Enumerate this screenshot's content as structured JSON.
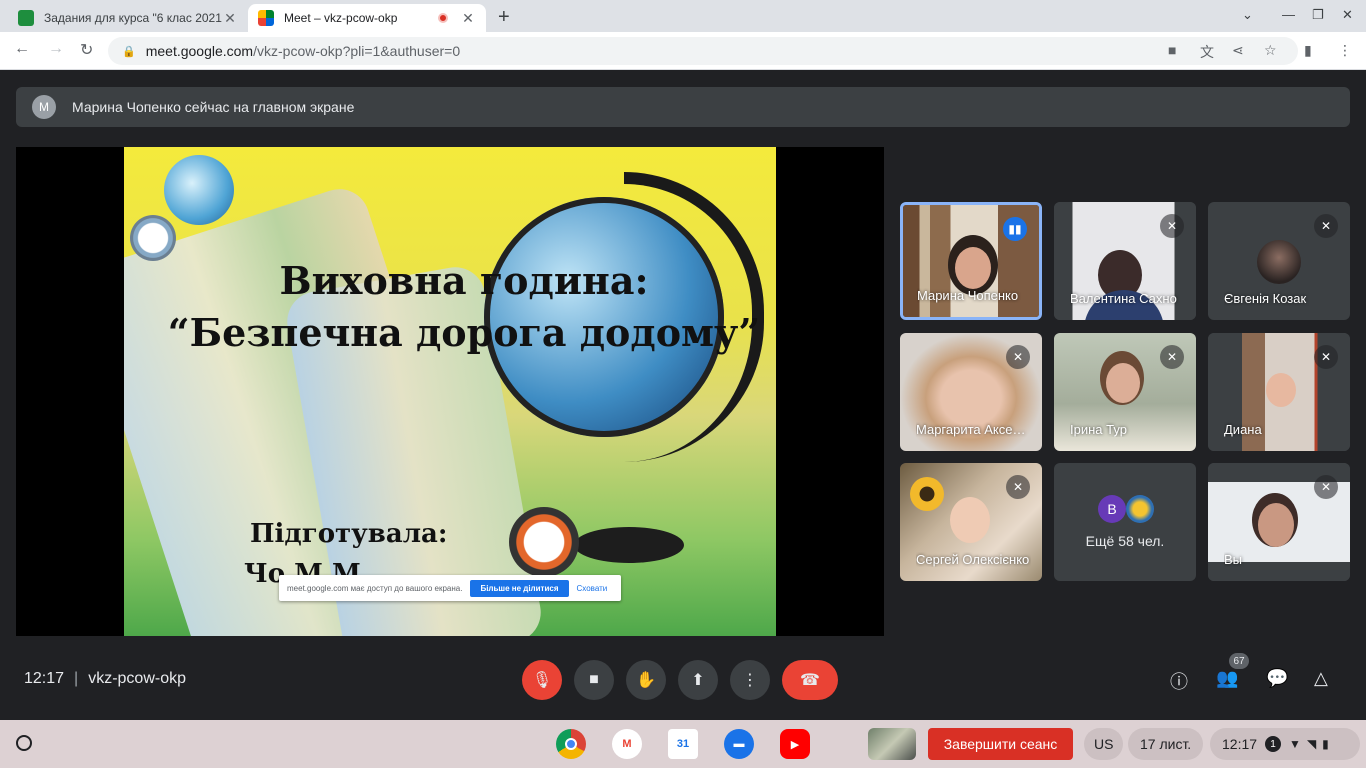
{
  "browser": {
    "tabs": [
      {
        "title": "Задания для курса \"6 клас 2021",
        "active": false
      },
      {
        "title": "Meet – vkz-pcow-okp",
        "active": true,
        "recording": true
      }
    ],
    "url_host": "meet.google.com",
    "url_path": "/vkz-pcow-okp?pli=1&authuser=0"
  },
  "banner": {
    "avatar_letter": "M",
    "text": "Марина Чопенко сейчас на главном экране"
  },
  "slide": {
    "title_line1": "Виховна година:",
    "title_line2": "“Безпечна дорога додому”",
    "author_label": "Підготувала:",
    "author_name": "Чо    М.М",
    "share_notice": "meet.google.com має доступ до вашого екрана.",
    "stop_sharing": "Більше не ділитися",
    "hide": "Сховати"
  },
  "participants": [
    {
      "name": "Марина Чопенко",
      "speaking": true
    },
    {
      "name": "Валентина Сахно",
      "muted": true
    },
    {
      "name": "Євгенія Козак",
      "muted": true
    },
    {
      "name": "Маргарита Аксенова",
      "muted": true
    },
    {
      "name": "Ірина Тур",
      "muted": true
    },
    {
      "name": "Диана",
      "muted": true
    },
    {
      "name": "Сергей Олексієнко",
      "muted": true
    },
    {
      "more_letter": "В",
      "more_text": "Ещё 58 чел."
    },
    {
      "name": "Вы",
      "muted": true
    }
  ],
  "meeting": {
    "time": "12:17",
    "code": "vkz-pcow-okp",
    "participant_count": "67"
  },
  "shelf": {
    "end_session": "Завершити сеанс",
    "keyboard": "US",
    "date": "17 лист.",
    "time": "12:17",
    "notif_count": "1"
  },
  "colors": {
    "meet_bg": "#202124",
    "tile_bg": "#3c4043",
    "danger": "#ea4335",
    "accent": "#1a73e8"
  }
}
